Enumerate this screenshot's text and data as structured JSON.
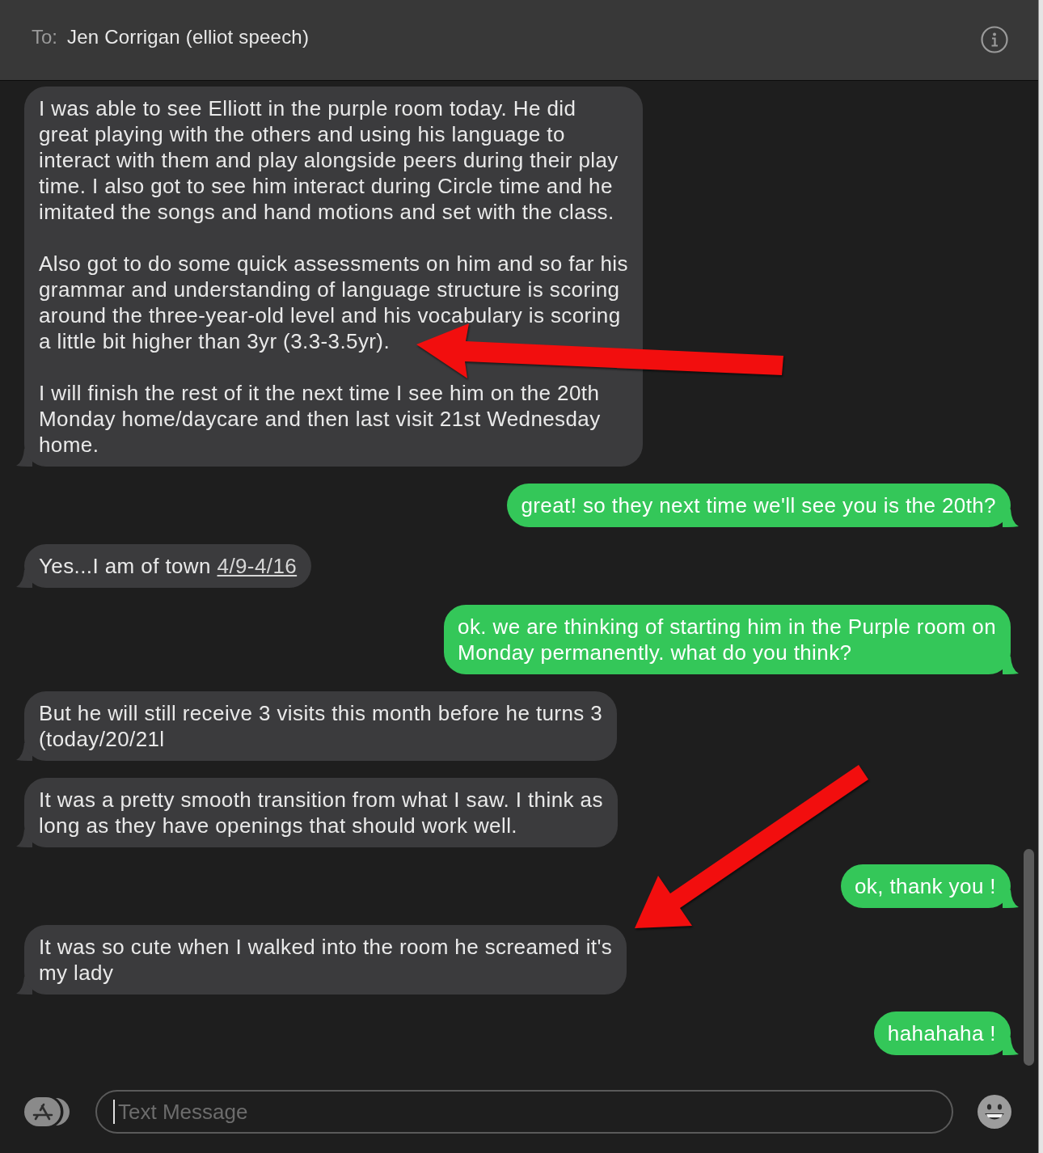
{
  "header": {
    "to_label": "To:",
    "recipient": "Jen Corrigan (elliot speech)"
  },
  "messages": [
    {
      "kind": "received",
      "paragraphs": [
        "I was able to see Elliott in the purple room today. He did\ngreat playing with the others and using his language to\ninteract with them and play alongside peers during their play\ntime. I also got to see him interact during Circle time and he\nimitated the songs and hand motions and set with the class.",
        "Also got to do some quick assessments on him and so far his\ngrammar and understanding of language structure is scoring\naround the three-year-old level and his vocabulary is scoring\na little bit higher than 3yr (3.3-3.5yr).",
        "I will finish the rest of it the next time I see him on the 20th\nMonday home/daycare and then last visit 21st Wednesday\nhome."
      ]
    },
    {
      "kind": "sent",
      "paragraphs": [
        "great! so they next time we'll see you is the 20th?"
      ]
    },
    {
      "kind": "received",
      "paragraphs": [
        "Yes...I am of town"
      ],
      "link": "4/9-4/16"
    },
    {
      "kind": "sent",
      "paragraphs": [
        "ok. we are thinking of starting him in the Purple room on\nMonday permanently. what do you think?"
      ]
    },
    {
      "kind": "received",
      "paragraphs": [
        "But he will still receive 3 visits this month before he turns 3\n(today/20/21l"
      ]
    },
    {
      "kind": "received",
      "paragraphs": [
        "It was a pretty smooth transition from what I saw. I think as\nlong as they have openings that should work well."
      ]
    },
    {
      "kind": "sent",
      "paragraphs": [
        "ok, thank you !"
      ]
    },
    {
      "kind": "received",
      "paragraphs": [
        "It was so cute when I walked into the room he screamed it's\nmy lady"
      ]
    },
    {
      "kind": "sent",
      "paragraphs": [
        "hahahaha !"
      ]
    }
  ],
  "annotations": [
    {
      "kind": "arrow"
    },
    {
      "kind": "arrow"
    }
  ],
  "compose": {
    "placeholder": "Text Message"
  }
}
